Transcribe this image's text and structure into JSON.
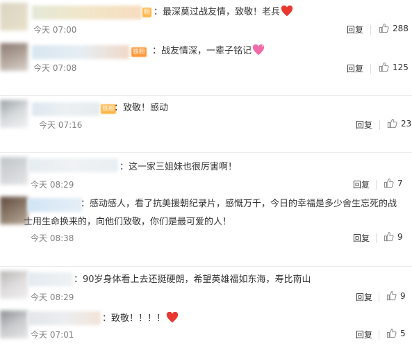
{
  "comments": [
    {
      "text": "：最深莫过战友情，致敬！老兵",
      "emoji": "heart-emoji",
      "time": "今天 07:00",
      "reply": "回复",
      "likes": "288",
      "badge": "粉"
    },
    {
      "text": "：战友情深，一辈子铭记",
      "emoji": "sparkle-heart-emoji",
      "time": "今天 07:08",
      "reply": "回复",
      "likes": "125",
      "badge": "铁粉"
    },
    {
      "text": "：致敬！感动",
      "time": "今天 07:16",
      "reply": "回复",
      "likes": "23",
      "badge": "铁粉"
    },
    {
      "text": "：这一家三姐妹也很厉害啊！",
      "time": "今天 08:29",
      "reply": "回复",
      "likes": "7"
    },
    {
      "text": "：感动感人，看了抗美援朝纪录片，感慨万千，今日的幸福是多少舍生忘死的战士用生命换来的，向他们致敬，你们是最可爱的人！",
      "time": "今天 08:38",
      "reply": "回复",
      "likes": "9"
    },
    {
      "text": "：90岁身体看上去还挺硬朗，希望英雄福如东海，寿比南山",
      "time": "今天 08:29",
      "reply": "回复",
      "likes": "9"
    },
    {
      "text": "：致敬！！！！",
      "emoji": "heart-emoji",
      "time": "今天 07:01",
      "reply": "回复",
      "likes": "5"
    }
  ],
  "colors": {
    "accent": "#ff8200",
    "heart": "#e8382f",
    "muted": "#808080"
  }
}
